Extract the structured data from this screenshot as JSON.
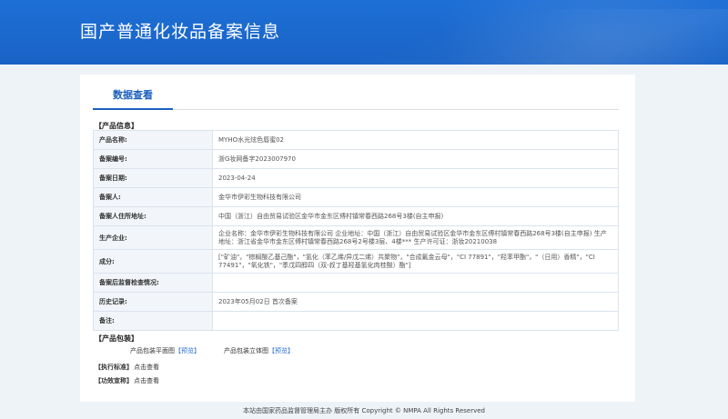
{
  "header": {
    "title": "国产普通化妆品备案信息"
  },
  "tabs": [
    {
      "label": "数据查看"
    }
  ],
  "product_info": {
    "section_label": "【产品信息】",
    "rows": [
      {
        "key": "产品名称:",
        "value": "MYHO水光炫色唇蜜02"
      },
      {
        "key": "备案编号:",
        "value": "浙G妆网备字2023007970"
      },
      {
        "key": "备案日期:",
        "value": "2023-04-24"
      },
      {
        "key": "备案人:",
        "value": "金华市伊彩生物科技有限公司"
      },
      {
        "key": "备案人住所地址:",
        "value": "中国（浙江）自由贸易试验区金华市金东区傅村镇常春西路268号3楼(自主申报)"
      },
      {
        "key": "生产企业:",
        "value": "企业名称：金华市伊彩生物科技有限公司 企业地址：中国（浙江）自由贸易试验区金华市金东区傅村镇常春西路268号3楼(自主申报) 生产地址：浙江省金华市金东区傅村镇常春西路268号2号楼3层、4楼*** 生产许可证：浙妆20210038"
      },
      {
        "key": "成分:",
        "value": "[\"矿油\"，\"棕榈酸乙基己酯\"，\"氢化（苯乙烯/异戊二烯）共聚物\"，\"合成氟金云母\"，\"CI 77891\"，\"羟苯甲酯\"，\"（日用）香精\"，\"CI 77491\"，\"氧化铁\"，\"季戊四醇四（双-叔丁基羟基氢化肉桂酸）酯\"]"
      },
      {
        "key": "备案后监督检查情况:",
        "value": ""
      },
      {
        "key": "历史记录:",
        "value": "2023年05月02日 首次备案"
      },
      {
        "key": "备注:",
        "value": ""
      }
    ]
  },
  "packaging": {
    "section_label": "【产品包装】",
    "flat_label": "产品包装平面图",
    "flat_link": "【预览】",
    "solid_label": "产品包装立体图",
    "solid_link": "【预览】"
  },
  "standard": {
    "label": "【执行标准】",
    "link": "点击查看"
  },
  "efficacy": {
    "label": "【功效宣称】",
    "link": "点击查看"
  },
  "footer": {
    "text": "本站由国家药品监督管理局主办 版权所有 Copyright © NMPA All Rights Reserved"
  },
  "colors": {
    "banner": "#1a63c6",
    "accent": "#1b5fbd",
    "link": "#2a6fd0"
  }
}
